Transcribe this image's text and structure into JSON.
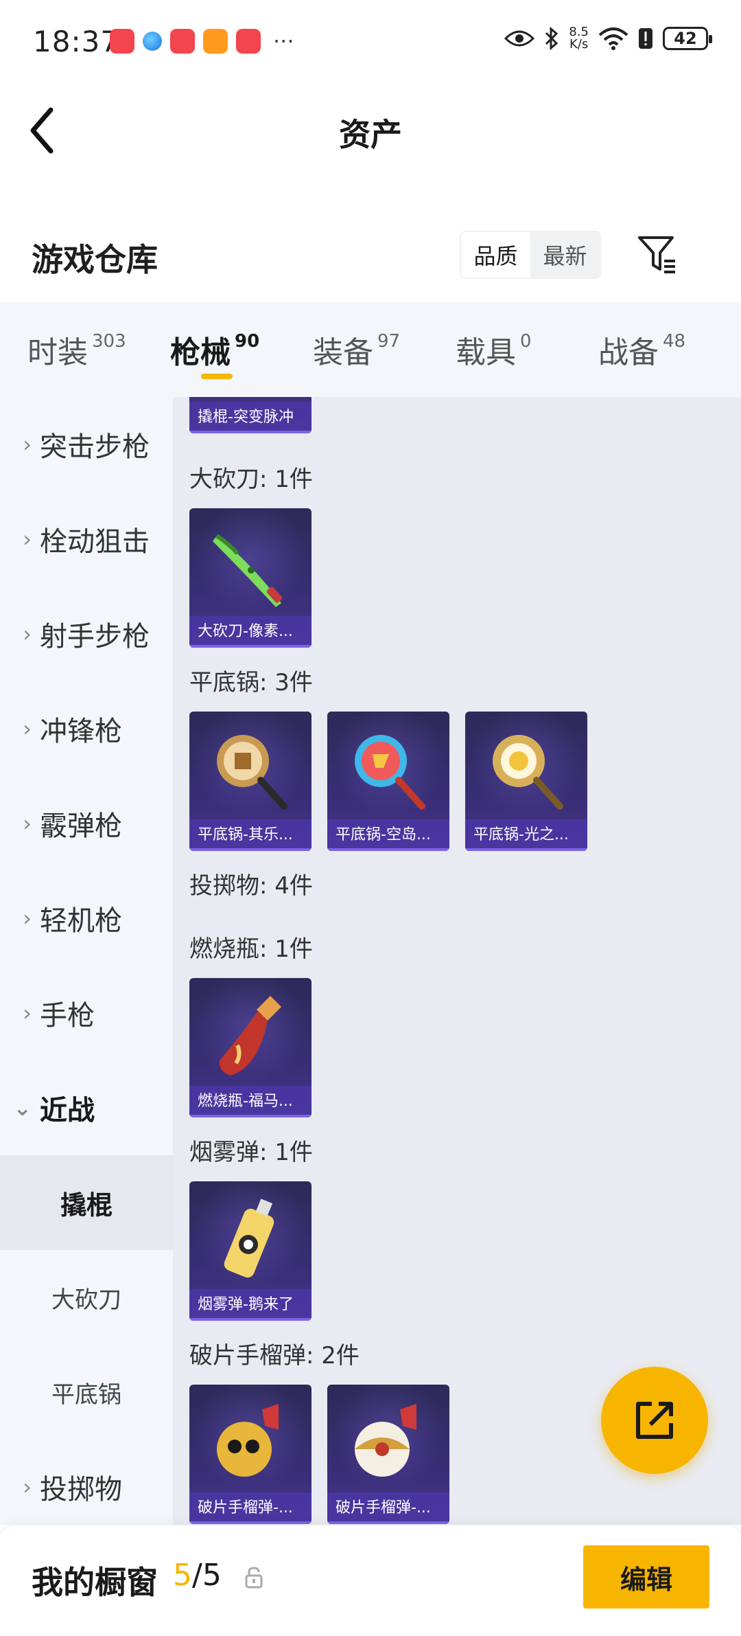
{
  "status_bar": {
    "time": "18:37",
    "net_speed_value": "8.5",
    "net_speed_unit": "K/s",
    "battery": "42"
  },
  "header": {
    "title": "资产",
    "back_icon": "chevron-left-icon"
  },
  "warehouse": {
    "title": "游戏仓库",
    "sort_options": [
      "品质",
      "最新"
    ],
    "sort_selected": "品质",
    "filter_icon": "filter-icon"
  },
  "category_tabs": [
    {
      "label": "时装",
      "count": "303",
      "active": false
    },
    {
      "label": "枪械",
      "count": "90",
      "active": true
    },
    {
      "label": "装备",
      "count": "97",
      "active": false
    },
    {
      "label": "载具",
      "count": "0",
      "active": false
    },
    {
      "label": "战备",
      "count": "48",
      "active": false
    }
  ],
  "sidebar": {
    "items": [
      {
        "label": "突击步枪",
        "expanded": false
      },
      {
        "label": "栓动狙击",
        "expanded": false
      },
      {
        "label": "射手步枪",
        "expanded": false
      },
      {
        "label": "冲锋枪",
        "expanded": false
      },
      {
        "label": "霰弹枪",
        "expanded": false
      },
      {
        "label": "轻机枪",
        "expanded": false
      },
      {
        "label": "手枪",
        "expanded": false
      },
      {
        "label": "近战",
        "expanded": true
      },
      {
        "label": "撬棍",
        "sub": true,
        "active": true
      },
      {
        "label": "大砍刀",
        "sub": true,
        "active": false
      },
      {
        "label": "平底锅",
        "sub": true,
        "active": false
      },
      {
        "label": "投掷物",
        "expanded": false
      }
    ]
  },
  "content": {
    "partial_item": "撬棍-突变脉冲",
    "groups": [
      {
        "label": "大砍刀: 1件",
        "items": [
          "大砍刀-像素..."
        ]
      },
      {
        "label": "平底锅: 3件",
        "items": [
          "平底锅-其乐...",
          "平底锅-空岛...",
          "平底锅-光之..."
        ]
      },
      {
        "label": "投掷物: 4件",
        "items": []
      },
      {
        "label": "燃烧瓶: 1件",
        "items": [
          "燃烧瓶-福马..."
        ]
      },
      {
        "label": "烟雾弹: 1件",
        "items": [
          "烟雾弹-鹅来了"
        ]
      },
      {
        "label": "破片手榴弹: 2件",
        "items": [
          "破片手榴弹-...",
          "破片手榴弹-..."
        ]
      }
    ]
  },
  "fab": {
    "icon": "share-external-icon"
  },
  "bottom_bar": {
    "title": "我的橱窗",
    "count_current": "5",
    "count_sep": "/",
    "count_total": "5",
    "lock_icon": "lock-icon",
    "edit_label": "编辑"
  },
  "colors": {
    "accent": "#f7b500",
    "card_bg": "#3b2f7a",
    "card_label_bg": "#4a36a0",
    "sidebar_bg": "#f3f6fa",
    "content_bg": "#e8ebf1"
  }
}
